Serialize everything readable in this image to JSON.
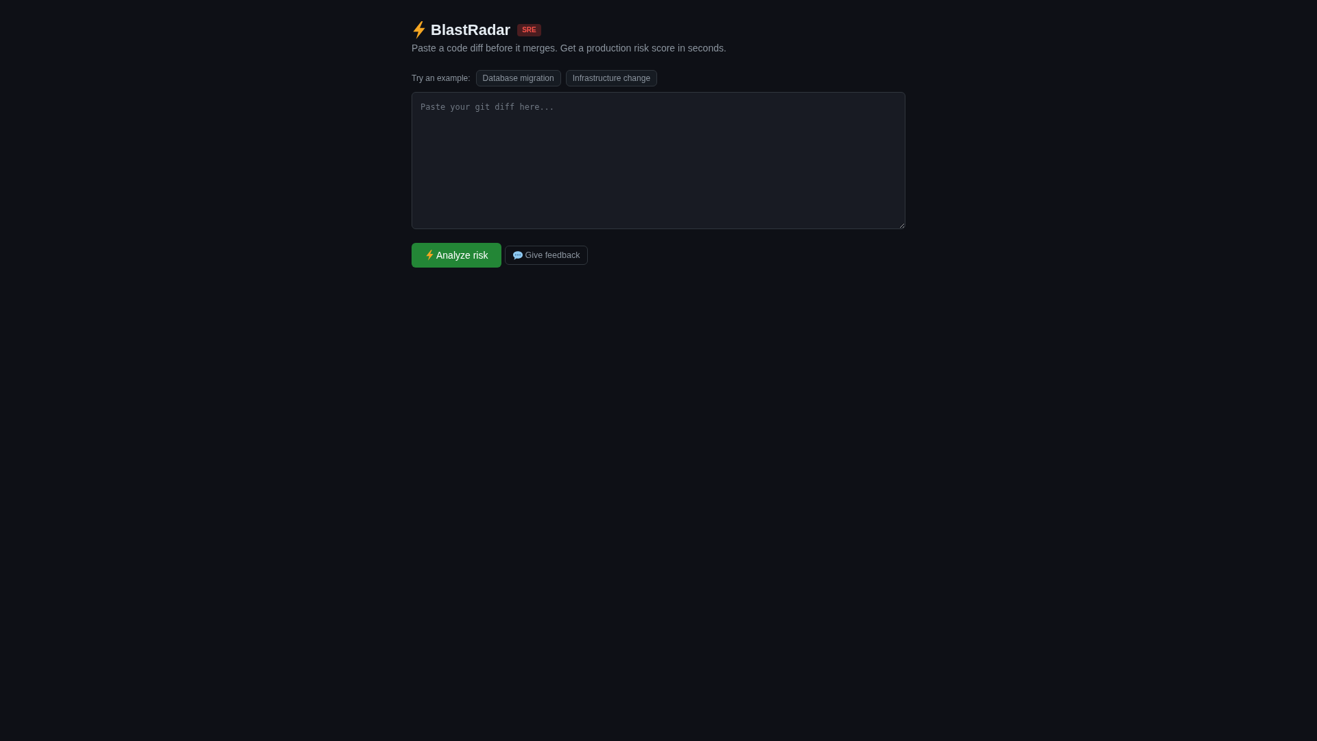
{
  "header": {
    "title": "BlastRadar",
    "badge": "SRE",
    "subtitle": "Paste a code diff before it merges. Get a production risk score in seconds."
  },
  "examples": {
    "label": "Try an example:",
    "chips": [
      "Database migration",
      "Infrastructure change"
    ]
  },
  "diff_input": {
    "placeholder": "Paste your git diff here..."
  },
  "actions": [
    {
      "kind": "primary",
      "label": "Analyze risk"
    },
    {
      "kind": "secondary",
      "label": "Give feedback"
    }
  ]
}
